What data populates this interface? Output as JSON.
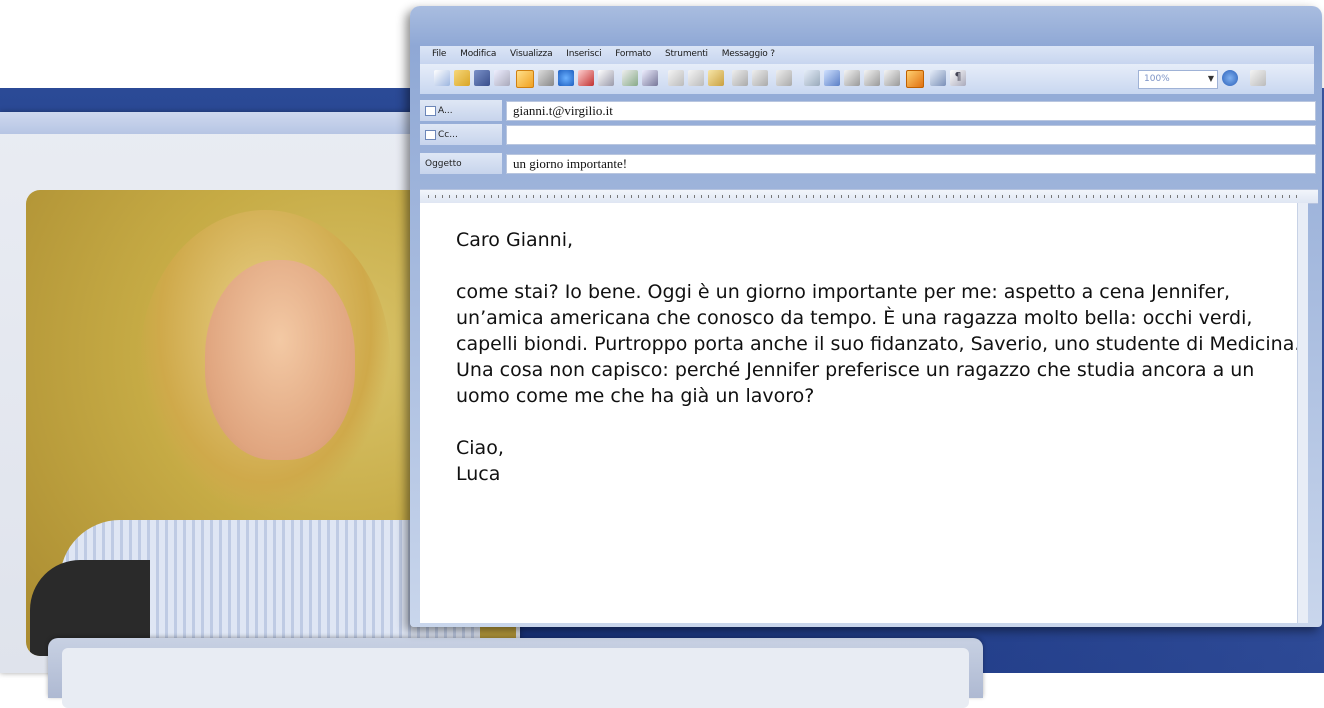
{
  "menu": [
    "File",
    "Modifica",
    "Visualizza",
    "Inserisci",
    "Formato",
    "Strumenti",
    "Messaggio ?"
  ],
  "toolbar": {
    "zoom": "100%"
  },
  "headers": {
    "to_label": "A...",
    "to_value": "gianni.t@virgilio.it",
    "cc_label": "Cc...",
    "cc_value": "",
    "subject_label": "Oggetto",
    "subject_value": "un giorno importante!"
  },
  "body": {
    "greeting": "Caro Gianni,",
    "p1": "come stai? Io bene. Oggi è un giorno importante per me: aspetto a cena Jennifer, un’amica americana che conosco da tempo. È una ragazza molto bella: occhi verdi, capelli biondi. Purtroppo porta anche il suo fidanzato, Saverio, uno studente di Medicina.",
    "p2": "Una cosa non capisco: perché Jennifer preferisce un ragazzo che studia ancora a un uomo come me che ha già un lavoro?",
    "closing": "Ciao,",
    "signature": "Luca"
  },
  "icons": [
    "new-icon",
    "open-icon",
    "save-icon",
    "print-icon",
    "spell-icon",
    "cut-icon",
    "copy-icon",
    "paste-icon",
    "undo-icon",
    "redo-icon",
    "table-icon",
    "help-icon"
  ]
}
